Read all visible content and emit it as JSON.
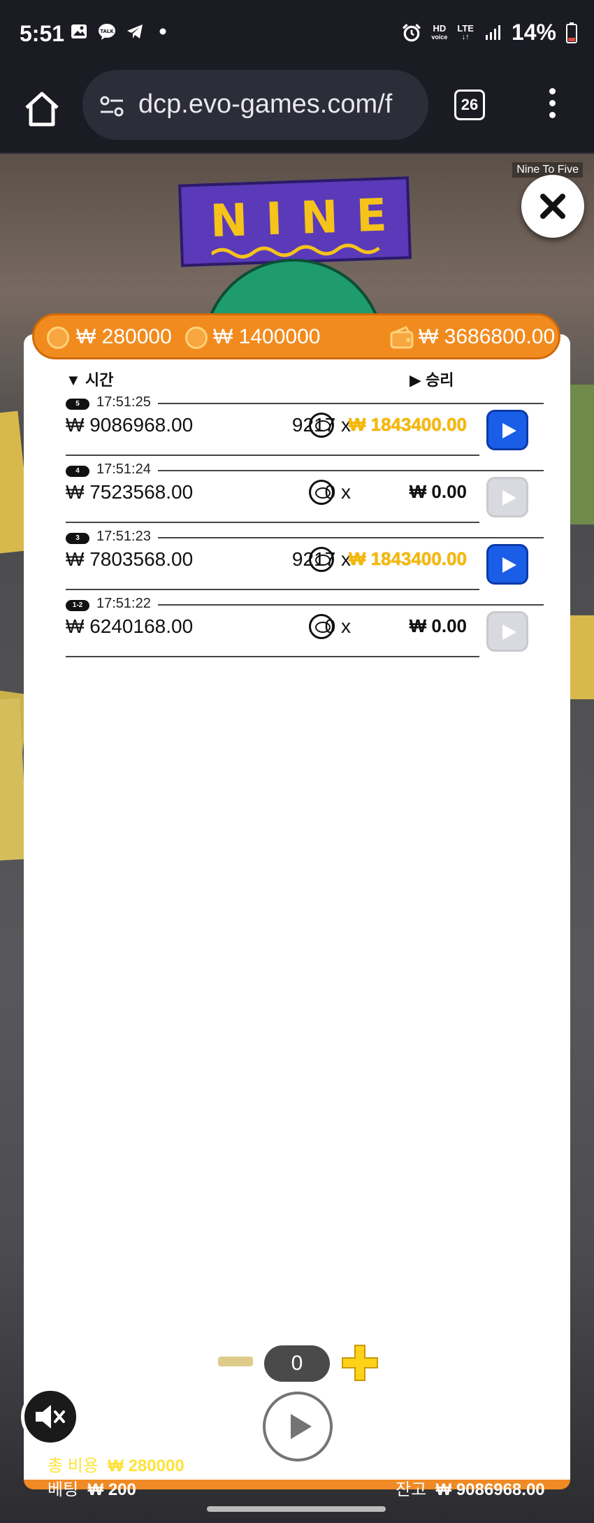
{
  "status_bar": {
    "time": "5:51",
    "network": "LTE",
    "hd_label": "HD",
    "voice_label": "voice",
    "battery": "14%"
  },
  "browser": {
    "url": "dcp.evo-games.com/f",
    "tab_count": "26"
  },
  "game": {
    "title_tag": "Nine To Five",
    "logo_text": "NINE",
    "summary": {
      "coin_value_1": "₩ 280000",
      "coin_value_2": "₩ 1400000",
      "wallet_value": "₩ 3686800.00"
    },
    "headers": {
      "time": "시간",
      "win": "승리"
    },
    "rows": [
      {
        "badge": "5",
        "time": "17:51:25",
        "balance": "₩ 9086968.00",
        "multiplier": "9217 x",
        "win": "₩ 1843400.00",
        "win_style": "gold",
        "play_active": true
      },
      {
        "badge": "4",
        "time": "17:51:24",
        "balance": "₩ 7523568.00",
        "multiplier": "0 x",
        "win": "₩ 0.00",
        "win_style": "black",
        "play_active": false
      },
      {
        "badge": "3",
        "time": "17:51:23",
        "balance": "₩ 7803568.00",
        "multiplier": "9217 x",
        "win": "₩ 1843400.00",
        "win_style": "gold",
        "play_active": true
      },
      {
        "badge": "1-2",
        "time": "17:51:22",
        "balance": "₩ 6240168.00",
        "multiplier": "0 x",
        "win": "₩ 0.00",
        "win_style": "black",
        "play_active": false
      }
    ],
    "controls": {
      "bet_count": "0",
      "total_cost_label": "총 비용",
      "total_cost_value": "₩ 280000",
      "bet_label": "베팅",
      "bet_value": "₩ 200",
      "balance_label": "잔고",
      "balance_value": "₩ 9086968.00"
    },
    "colors": {
      "accent_orange": "#f28b1e",
      "play_blue": "#1a5ee8",
      "win_gold": "#f5b800"
    }
  }
}
